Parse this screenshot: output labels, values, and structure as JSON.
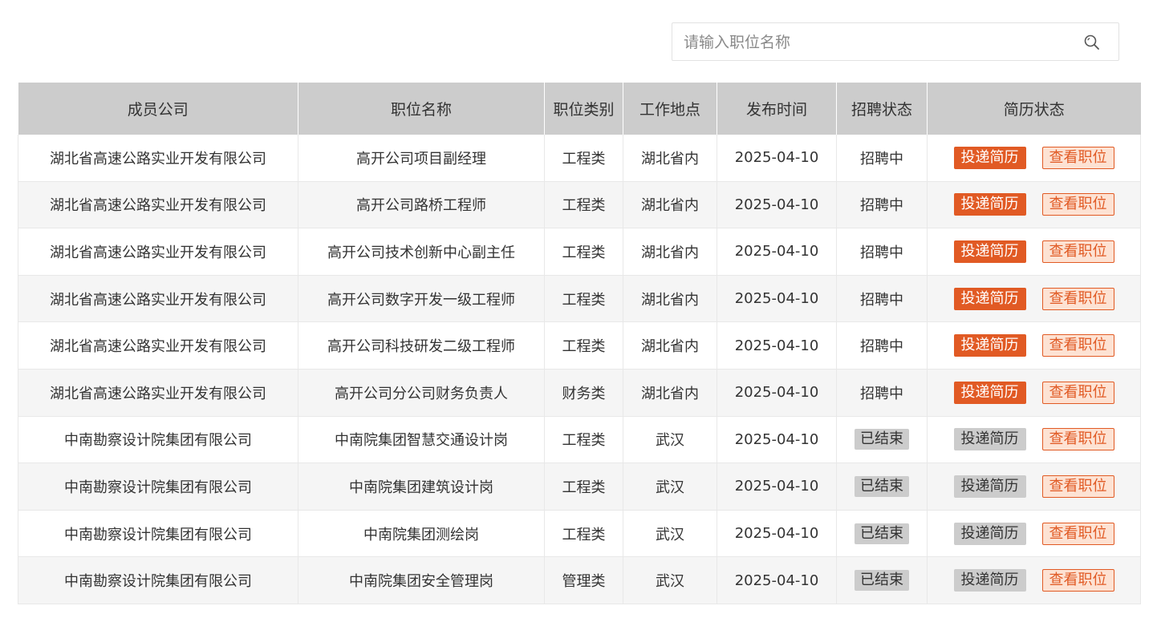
{
  "search": {
    "placeholder": "请输入职位名称",
    "value": "",
    "icon": "search-icon"
  },
  "table": {
    "headers": [
      "成员公司",
      "职位名称",
      "职位类别",
      "工作地点",
      "发布时间",
      "招聘状态",
      "简历状态"
    ],
    "apply_label": "投递简历",
    "view_label": "查看职位",
    "rows": [
      {
        "company": "湖北省高速公路实业开发有限公司",
        "position": "高开公司项目副经理",
        "category": "工程类",
        "location": "湖北省内",
        "date": "2025-04-10",
        "status": "招聘中",
        "open": true
      },
      {
        "company": "湖北省高速公路实业开发有限公司",
        "position": "高开公司路桥工程师",
        "category": "工程类",
        "location": "湖北省内",
        "date": "2025-04-10",
        "status": "招聘中",
        "open": true
      },
      {
        "company": "湖北省高速公路实业开发有限公司",
        "position": "高开公司技术创新中心副主任",
        "category": "工程类",
        "location": "湖北省内",
        "date": "2025-04-10",
        "status": "招聘中",
        "open": true
      },
      {
        "company": "湖北省高速公路实业开发有限公司",
        "position": "高开公司数字开发一级工程师",
        "category": "工程类",
        "location": "湖北省内",
        "date": "2025-04-10",
        "status": "招聘中",
        "open": true
      },
      {
        "company": "湖北省高速公路实业开发有限公司",
        "position": "高开公司科技研发二级工程师",
        "category": "工程类",
        "location": "湖北省内",
        "date": "2025-04-10",
        "status": "招聘中",
        "open": true
      },
      {
        "company": "湖北省高速公路实业开发有限公司",
        "position": "高开公司分公司财务负责人",
        "category": "财务类",
        "location": "湖北省内",
        "date": "2025-04-10",
        "status": "招聘中",
        "open": true
      },
      {
        "company": "中南勘察设计院集团有限公司",
        "position": "中南院集团智慧交通设计岗",
        "category": "工程类",
        "location": "武汉",
        "date": "2025-04-10",
        "status": "已结束",
        "open": false
      },
      {
        "company": "中南勘察设计院集团有限公司",
        "position": "中南院集团建筑设计岗",
        "category": "工程类",
        "location": "武汉",
        "date": "2025-04-10",
        "status": "已结束",
        "open": false
      },
      {
        "company": "中南勘察设计院集团有限公司",
        "position": "中南院集团测绘岗",
        "category": "工程类",
        "location": "武汉",
        "date": "2025-04-10",
        "status": "已结束",
        "open": false
      },
      {
        "company": "中南勘察设计院集团有限公司",
        "position": "中南院集团安全管理岗",
        "category": "管理类",
        "location": "武汉",
        "date": "2025-04-10",
        "status": "已结束",
        "open": false
      }
    ]
  },
  "colors": {
    "accent": "#e15a24",
    "accent_light": "#fde2d3",
    "header_bg": "#cccccc",
    "row_alt_bg": "#f5f5f5",
    "disabled_bg": "#cccccc"
  }
}
